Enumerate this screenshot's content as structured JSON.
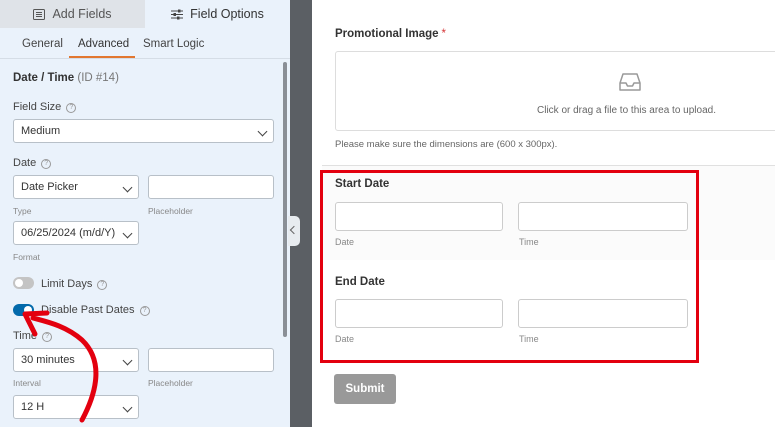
{
  "tabs": {
    "add_fields": "Add Fields",
    "field_options": "Field Options"
  },
  "subtabs": {
    "general": "General",
    "advanced": "Advanced",
    "smart_logic": "Smart Logic"
  },
  "field": {
    "title": "Date / Time",
    "id_text": "(ID #14)"
  },
  "field_size": {
    "label": "Field Size",
    "value": "Medium"
  },
  "date": {
    "label": "Date",
    "type_value": "Date Picker",
    "type_label": "Type",
    "placeholder_label": "Placeholder",
    "format_value": "06/25/2024 (m/d/Y)",
    "format_label": "Format"
  },
  "limit_days": {
    "label": "Limit Days",
    "enabled": false
  },
  "disable_past_dates": {
    "label": "Disable Past Dates",
    "enabled": true
  },
  "time": {
    "label": "Time",
    "interval_value": "30 minutes",
    "interval_label": "Interval",
    "placeholder_label": "Placeholder",
    "format_value": "12 H"
  },
  "preview": {
    "promo_label": "Promotional Image",
    "required_mark": "*",
    "upload_text": "Click or drag a file to this area to upload.",
    "hint": "Please make sure the dimensions are (600 x 300px).",
    "start_date": {
      "label": "Start Date",
      "date_sub": "Date",
      "time_sub": "Time"
    },
    "end_date": {
      "label": "End Date",
      "date_sub": "Date",
      "time_sub": "Time"
    },
    "submit": "Submit"
  },
  "colors": {
    "accent": "#e27730",
    "toggle_on": "#036aab",
    "highlight": "#e3000f",
    "arrow": "#e3000f"
  },
  "icons": {
    "add_fields": "list-icon",
    "field_options": "sliders-icon",
    "upload": "inbox-icon",
    "help": "question-icon"
  }
}
